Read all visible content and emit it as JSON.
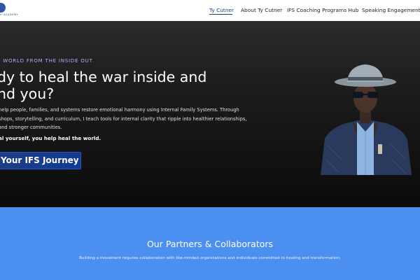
{
  "header": {
    "logo_sub": "H ACADEMY",
    "nav": [
      {
        "label": "Ty Cutner",
        "active": true
      },
      {
        "label": "About Ty Cutner",
        "active": false
      },
      {
        "label": "IFS Coaching Programs Hub",
        "active": false
      },
      {
        "label": "Speaking Engagements",
        "active": false
      }
    ]
  },
  "hero": {
    "eyebrow": "E WORLD FROM THE INSIDE OUT",
    "headline_lines": [
      "dy to heal the war inside and",
      "nd you?"
    ],
    "paragraph_lines": [
      "help people, families, and systems restore emotional harmony using Internal Family Systems. Through",
      "shops, storytelling, and curriculum, I teach tools for internal clarity that ripple into healthier relationships,",
      "and stronger communities."
    ],
    "tagline": "al yourself, you help heal the world.",
    "cta_label": "Your IFS Journey"
  },
  "partners": {
    "title": "Our Partners & Collaborators",
    "description": "Building a movement requires collaboration with like-minded organizations and individuals committed to healing and transformation."
  },
  "colors": {
    "hero_bg": "#1b1b1b",
    "accent_eyebrow": "#b9a9ff",
    "cta_bg": "#1d3e86",
    "partners_bg": "#4b8ff0",
    "nav_active": "#1f3f7a"
  }
}
